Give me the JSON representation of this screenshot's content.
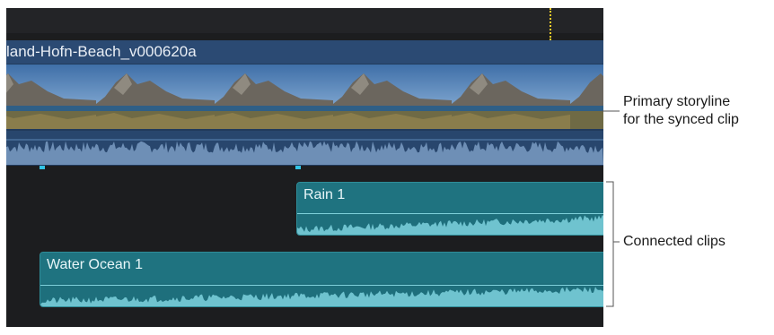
{
  "primary_clip": {
    "title": "land-Hofn-Beach_v000620a"
  },
  "connected_clips": [
    {
      "title": "Rain 1"
    },
    {
      "title": "Water Ocean 1"
    }
  ],
  "callouts": {
    "primary_line1": "Primary storyline",
    "primary_line2": "for the synced clip",
    "connected": "Connected clips"
  },
  "colors": {
    "timeline_bg": "#1c1d1f",
    "primary_clip": "#2b4a73",
    "connected_clip": "#1e6f7c",
    "playhead": "#f1cc2b",
    "marker": "#33c4e6"
  }
}
